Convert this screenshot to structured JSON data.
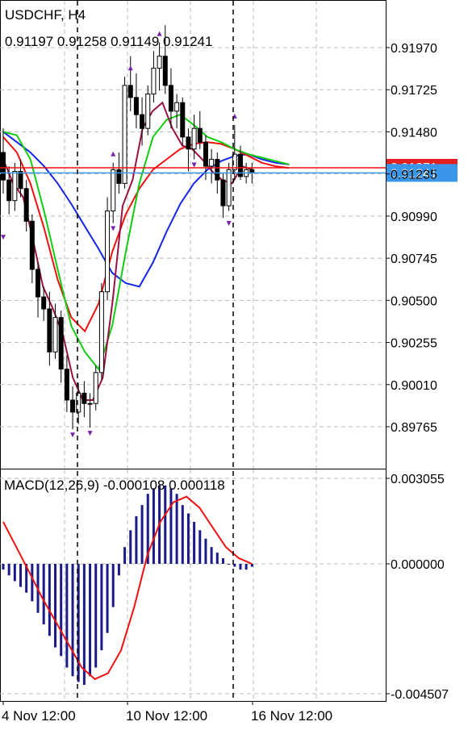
{
  "chart_header": {
    "symbol_timeframe": "USDCHF, H4",
    "ohlc": "0.91197 0.91258 0.91149 0.91241"
  },
  "macd_header": {
    "label": "MACD(12,26,9) -0.000108 0.000118"
  },
  "price_badges": {
    "bid_label": "0.91241",
    "red_level_label": "0.91271"
  },
  "colors": {
    "candle": "#000000",
    "ma_blue": "#1428e6",
    "ma_red": "#ee1111",
    "ma_green": "#11cc11",
    "ma_purple": "#991144",
    "fractal": "#7722aa",
    "macd_hist": "#1a1a88",
    "macd_signal": "#ee1111",
    "bid_line": "#3a96e8",
    "grid": "#bbbbbb"
  },
  "chart_data": [
    {
      "type": "candlestick",
      "title": "USDCHF, H4",
      "yticks": [
        "0.91970",
        "0.91725",
        "0.91480",
        "0.91235",
        "0.90990",
        "0.90745",
        "0.90500",
        "0.90255",
        "0.90010",
        "0.89765"
      ],
      "ylim": [
        0.8962,
        0.923
      ],
      "xticks": [
        "4 Nov 12:00",
        "10 Nov 12:00",
        "16 Nov 12:00"
      ],
      "current_price": 0.91241,
      "red_level": 0.91271,
      "candles": [
        [
          0.9136,
          0.915,
          0.9112,
          0.912
        ],
        [
          0.912,
          0.9128,
          0.91,
          0.9108
        ],
        [
          0.9108,
          0.913,
          0.9102,
          0.9125
        ],
        [
          0.9125,
          0.9132,
          0.911,
          0.9115
        ],
        [
          0.9115,
          0.912,
          0.909,
          0.9096
        ],
        [
          0.9096,
          0.91,
          0.906,
          0.9068
        ],
        [
          0.9068,
          0.9072,
          0.904,
          0.9052
        ],
        [
          0.9052,
          0.9058,
          0.9038,
          0.9045
        ],
        [
          0.9045,
          0.9055,
          0.9012,
          0.902
        ],
        [
          0.902,
          0.9048,
          0.9016,
          0.904
        ],
        [
          0.904,
          0.9044,
          0.9002,
          0.901
        ],
        [
          0.901,
          0.9018,
          0.8985,
          0.8992
        ],
        [
          0.8992,
          0.9,
          0.8975,
          0.8985
        ],
        [
          0.8985,
          0.9002,
          0.8978,
          0.8996
        ],
        [
          0.8996,
          0.9003,
          0.8982,
          0.899
        ],
        [
          0.899,
          0.8996,
          0.8976,
          0.899
        ],
        [
          0.899,
          0.9012,
          0.8986,
          0.9008
        ],
        [
          0.9008,
          0.906,
          0.9004,
          0.9055
        ],
        [
          0.9055,
          0.911,
          0.905,
          0.9102
        ],
        [
          0.9102,
          0.913,
          0.9095,
          0.9126
        ],
        [
          0.9126,
          0.9136,
          0.9112,
          0.9118
        ],
        [
          0.9118,
          0.918,
          0.9115,
          0.9175
        ],
        [
          0.9175,
          0.9192,
          0.916,
          0.9168
        ],
        [
          0.9168,
          0.9182,
          0.915,
          0.9158
        ],
        [
          0.9158,
          0.9168,
          0.914,
          0.915
        ],
        [
          0.915,
          0.9175,
          0.9146,
          0.917
        ],
        [
          0.917,
          0.9195,
          0.9165,
          0.9185
        ],
        [
          0.9185,
          0.92,
          0.9172,
          0.9192
        ],
        [
          0.9192,
          0.921,
          0.917,
          0.9175
        ],
        [
          0.9175,
          0.9185,
          0.915,
          0.916
        ],
        [
          0.916,
          0.917,
          0.915,
          0.9165
        ],
        [
          0.9165,
          0.9168,
          0.914,
          0.9145
        ],
        [
          0.9145,
          0.915,
          0.9125,
          0.9138
        ],
        [
          0.9138,
          0.9158,
          0.9132,
          0.915
        ],
        [
          0.915,
          0.916,
          0.9138,
          0.9142
        ],
        [
          0.9142,
          0.9146,
          0.912,
          0.9128
        ],
        [
          0.9128,
          0.9138,
          0.9118,
          0.9132
        ],
        [
          0.9132,
          0.9136,
          0.9112,
          0.912
        ],
        [
          0.912,
          0.9124,
          0.9098,
          0.9105
        ],
        [
          0.9105,
          0.913,
          0.9102,
          0.9126
        ],
        [
          0.9126,
          0.9152,
          0.912,
          0.9135
        ],
        [
          0.9135,
          0.914,
          0.912,
          0.9122
        ],
        [
          0.9122,
          0.913,
          0.9118,
          0.9126
        ],
        [
          0.9126,
          0.913,
          0.9118,
          0.9124
        ]
      ],
      "ma_blue": [
        0.9148,
        0.9142,
        0.9136,
        0.9128,
        0.9118,
        0.9106,
        0.9093,
        0.908,
        0.9066,
        0.906,
        0.9058,
        0.9072,
        0.909,
        0.9106,
        0.9118,
        0.9126,
        0.9131,
        0.9134,
        0.9135,
        0.9132,
        0.913,
        0.9129
      ],
      "ma_red": [
        0.9145,
        0.9136,
        0.9118,
        0.9092,
        0.9062,
        0.904,
        0.9032,
        0.9048,
        0.9078,
        0.91,
        0.9115,
        0.9126,
        0.9132,
        0.9138,
        0.9141,
        0.9142,
        0.9141,
        0.9138,
        0.9134,
        0.913,
        0.9128,
        0.9127
      ],
      "ma_green": [
        0.9148,
        0.9146,
        0.9132,
        0.9102,
        0.9068,
        0.9035,
        0.902,
        0.901,
        0.9035,
        0.9078,
        0.9118,
        0.9145,
        0.9155,
        0.9158,
        0.9152,
        0.9145,
        0.9142,
        0.9138,
        0.9135,
        0.9133,
        0.9131,
        0.9129
      ],
      "ma_purple": [
        0.9132,
        0.9118,
        0.911,
        0.9085,
        0.9058,
        0.9045,
        0.903,
        0.9005,
        0.8992,
        0.8992,
        0.9005,
        0.905,
        0.9105,
        0.912,
        0.915,
        0.916,
        0.9165,
        0.915,
        0.914,
        0.9138,
        0.9132,
        0.9125,
        0.912,
        0.9118,
        0.9128,
        0.9126
      ]
    },
    {
      "type": "bar",
      "title": "MACD(12,26,9)",
      "yticks": [
        "0.003055",
        "0.000000",
        "-0.004507"
      ],
      "ylim": [
        -0.004507,
        0.003055
      ],
      "histogram": [
        -0.0002,
        -0.0004,
        -0.0006,
        -0.0008,
        -0.001,
        -0.0013,
        -0.0017,
        -0.0021,
        -0.0025,
        -0.0029,
        -0.0032,
        -0.0036,
        -0.0039,
        -0.0041,
        -0.0042,
        -0.0039,
        -0.0036,
        -0.003,
        -0.0024,
        -0.0015,
        -0.0004,
        0.0006,
        0.0012,
        0.0017,
        0.0021,
        0.0025,
        0.0027,
        0.0028,
        0.0028,
        0.0027,
        0.0025,
        0.0021,
        0.0018,
        0.0015,
        0.0012,
        0.0009,
        0.0006,
        0.0004,
        0.0002,
        0.0,
        -0.0001,
        -0.0002,
        -0.0002,
        -0.0001
      ],
      "signal": [
        0.0015,
        0.0006,
        -0.0003,
        -0.0012,
        -0.002,
        -0.0028,
        -0.0036,
        -0.004,
        -0.0038,
        -0.003,
        -0.0015,
        0.0003,
        0.0015,
        0.0022,
        0.0024,
        0.002,
        0.0013,
        0.0006,
        0.0002,
        0.0
      ]
    }
  ]
}
